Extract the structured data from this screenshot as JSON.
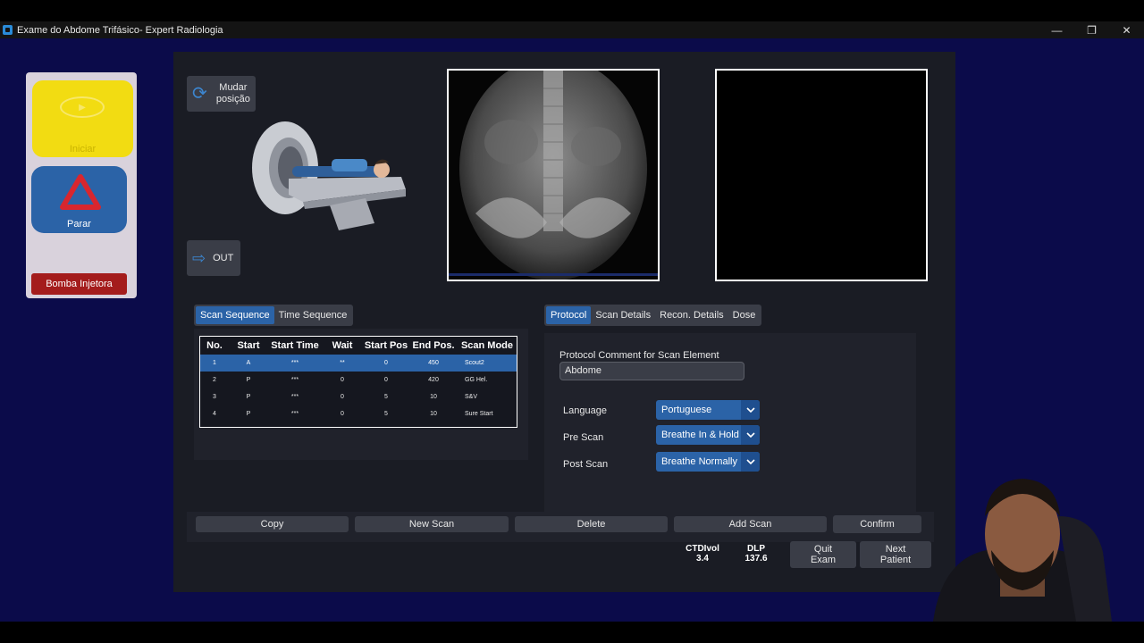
{
  "window": {
    "title": "Exame do Abdome Trifásico- Expert Radiologia",
    "controls": [
      "—",
      "❐",
      "✕"
    ]
  },
  "side": {
    "iniciar_label": "Iniciar",
    "parar_label": "Parar",
    "bomba_label": "Bomba Injetora"
  },
  "controls": {
    "mudar_label": "Mudar posição",
    "out_label": "OUT"
  },
  "scan_tabs": [
    "Scan Sequence",
    "Time Sequence"
  ],
  "table": {
    "headers": [
      "No.",
      "Start",
      "Start Time",
      "Wait",
      "Start Pos",
      "End Pos.",
      "Scan Mode"
    ],
    "rows": [
      [
        "1",
        "A",
        "***",
        "**",
        "0",
        "450",
        "Scout2"
      ],
      [
        "2",
        "P",
        "***",
        "0",
        "0",
        "420",
        "GG Hel."
      ],
      [
        "3",
        "P",
        "***",
        "0",
        "5",
        "10",
        "S&V"
      ],
      [
        "4",
        "P",
        "***",
        "0",
        "5",
        "10",
        "Sure Start"
      ]
    ]
  },
  "protocol_tabs": [
    "Protocol",
    "Scan Details",
    "Recon. Details",
    "Dose"
  ],
  "protocol": {
    "comment_label": "Protocol Comment for Scan Element",
    "comment_value": "Abdome",
    "language_label": "Language",
    "language_value": "Portuguese",
    "prescan_label": "Pre Scan",
    "prescan_value": "Breathe In & Hold",
    "postscan_label": "Post Scan",
    "postscan_value": "Breathe Normally"
  },
  "actions": {
    "copy": "Copy",
    "new_scan": "New Scan",
    "delete": "Delete",
    "add_scan": "Add Scan",
    "confirm": "Confirm"
  },
  "stats": {
    "ctdi_label": "CTDIvol",
    "ctdi_value": "3.4",
    "dlp_label": "DLP",
    "dlp_value": "137.6"
  },
  "nav": {
    "quit_line1": "Quit",
    "quit_line2": "Exam",
    "next_line1": "Next",
    "next_line2": "Patient"
  },
  "colors": {
    "accent": "#2b63a7",
    "background": "#0b0b4a",
    "panel": "#1a1c24",
    "start_button": "#f2dc12",
    "injector_button": "#a41c1c"
  }
}
